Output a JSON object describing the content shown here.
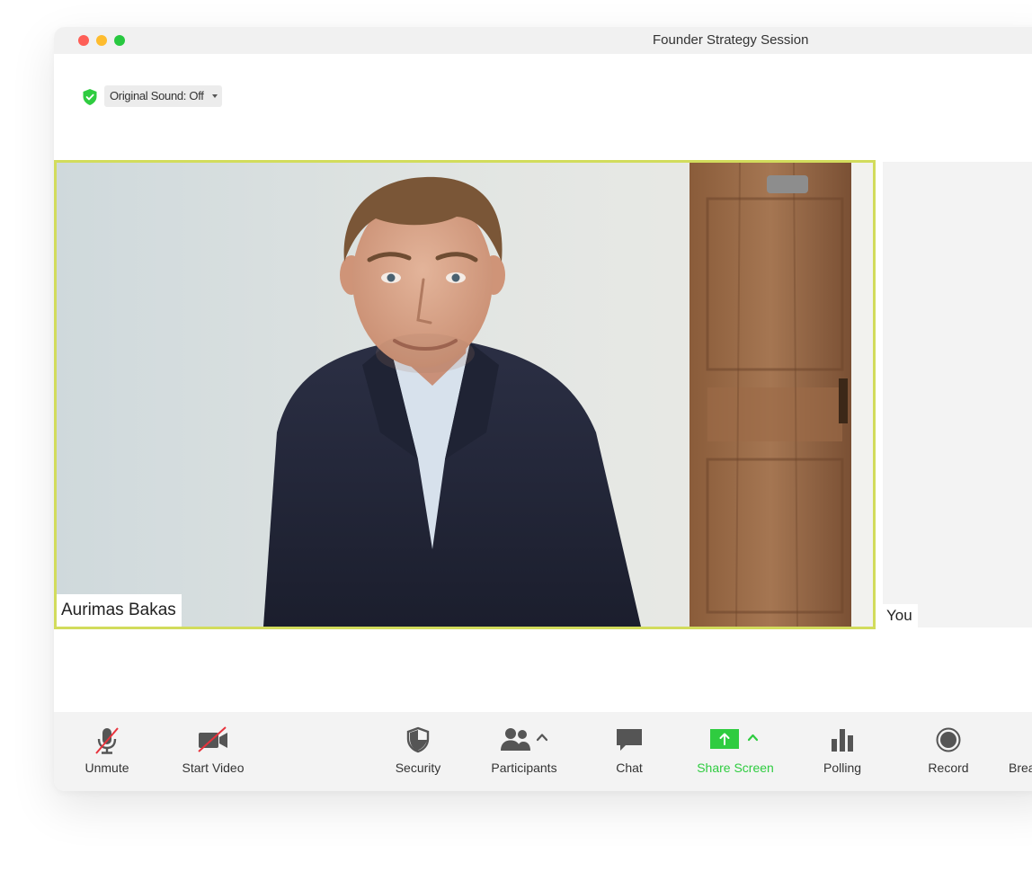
{
  "window": {
    "title": "Founder Strategy Session"
  },
  "audio": {
    "original_sound_label": "Original Sound: Off"
  },
  "participants": {
    "active_speaker_name": "Aurimas Bakas",
    "self_name": "You"
  },
  "toolbar": {
    "unmute_label": "Unmute",
    "start_video_label": "Start Video",
    "security_label": "Security",
    "participants_label": "Participants",
    "chat_label": "Chat",
    "share_screen_label": "Share Screen",
    "polling_label": "Polling",
    "record_label": "Record",
    "breakout_label": "Brea"
  },
  "colors": {
    "accent_green": "#2fcc40",
    "speaker_border": "#d2dc5c",
    "mute_slash": "#e8323c",
    "toolbar_bg": "#f3f3f3",
    "close": "#fe5f57",
    "minimize": "#febc2e",
    "maximize": "#28c840"
  },
  "icons": {
    "security": "shield-icon",
    "audio": "mic-muted-icon",
    "video": "camera-off-icon",
    "participants": "people-icon",
    "chat": "chat-bubble-icon",
    "share": "share-screen-icon",
    "polling": "bar-chart-icon",
    "record": "record-icon"
  }
}
